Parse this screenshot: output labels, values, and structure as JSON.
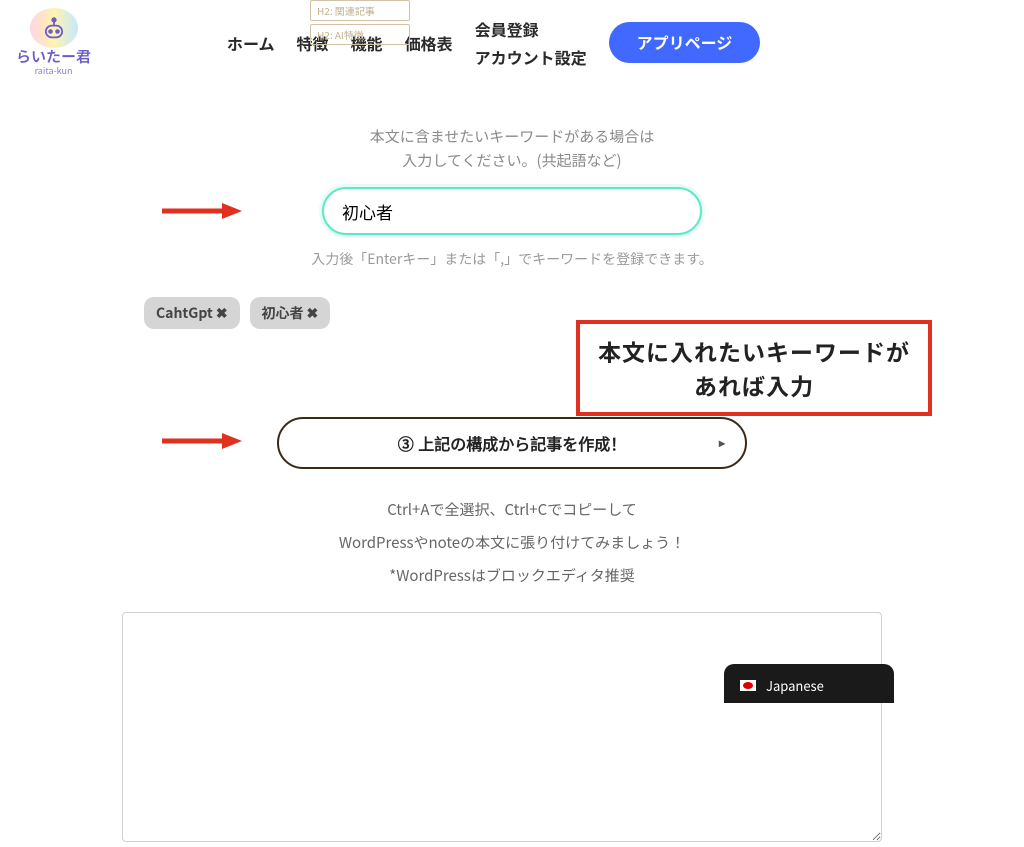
{
  "logo": {
    "text": "らいたー君",
    "sub": "raita-kun"
  },
  "nav": {
    "home": "ホーム",
    "features": "特徴",
    "functions": "機能",
    "pricing": "価格表",
    "register": "会員登録",
    "account": "アカウント設定",
    "app_button": "アプリページ"
  },
  "bg_hints": {
    "line1": "H2: 関連記事",
    "line2": "H2: AI特徴"
  },
  "keyword_section": {
    "instruction_line1": "本文に含ませたいキーワードがある場合は",
    "instruction_line2": "入力してください。(共起語など)",
    "input_value": "初心者",
    "hint": "入力後「Enterキー」または「,」でキーワードを登録できます。"
  },
  "tags": [
    {
      "label": "CahtGpt"
    },
    {
      "label": "初心者"
    }
  ],
  "annotation": {
    "line1": "本文に入れたいキーワードが",
    "line2": "あれば入力"
  },
  "generate_button": "③ 上記の構成から記事を作成！",
  "tips": {
    "line1": "Ctrl+Aで全選択、Ctrl+Cでコピーして",
    "line2": "WordPressやnoteの本文に張り付けてみましょう！",
    "line3": "*WordPressはブロックエディタ推奨"
  },
  "lang": {
    "label": "Japanese"
  }
}
